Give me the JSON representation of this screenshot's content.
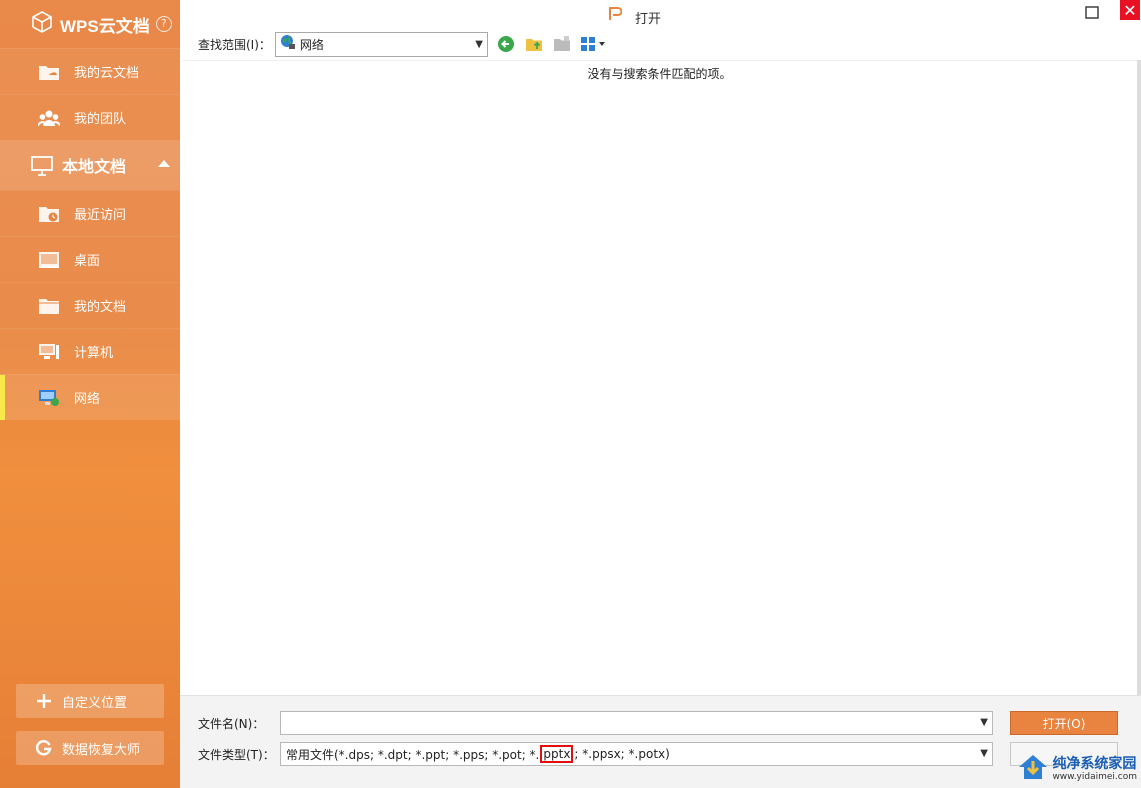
{
  "sidebar": {
    "brand": "WPS云文档",
    "help": "?",
    "cloud_items": [
      {
        "label": "我的云文档",
        "icon": "cloud-folder-icon"
      },
      {
        "label": "我的团队",
        "icon": "team-icon"
      }
    ],
    "section": {
      "label": "本地文档",
      "icon": "monitor-icon"
    },
    "local_items": [
      {
        "label": "最近访问",
        "icon": "recent-folder-icon"
      },
      {
        "label": "桌面",
        "icon": "desktop-icon"
      },
      {
        "label": "我的文档",
        "icon": "folder-icon"
      },
      {
        "label": "计算机",
        "icon": "computer-icon"
      },
      {
        "label": "网络",
        "icon": "network-icon"
      }
    ],
    "custom_location": "自定义位置",
    "recovery": "数据恢复大师"
  },
  "dialog": {
    "title": "打开",
    "close": "✕",
    "lookin_label": "查找范围(I)：",
    "lookin_value": "网络",
    "empty_message": "没有与搜索条件匹配的项。",
    "filename_label": "文件名(N)：",
    "filename_value": "",
    "filetype_label": "文件类型(T)：",
    "filetype_prefix": "常用文件(*.dps; *.dpt; *.ppt; *.pps; *.pot; *.",
    "filetype_highlight": "pptx",
    "filetype_suffix": "; *.ppsx; *.potx)",
    "open_button": "打开(O)"
  },
  "watermark": {
    "title": "纯净系统家园",
    "url": "www.yidaimei.com"
  },
  "colors": {
    "accent": "#e8843f",
    "active_marker": "#f7e94a",
    "highlight_box": "#e01010",
    "close": "#e81123"
  }
}
